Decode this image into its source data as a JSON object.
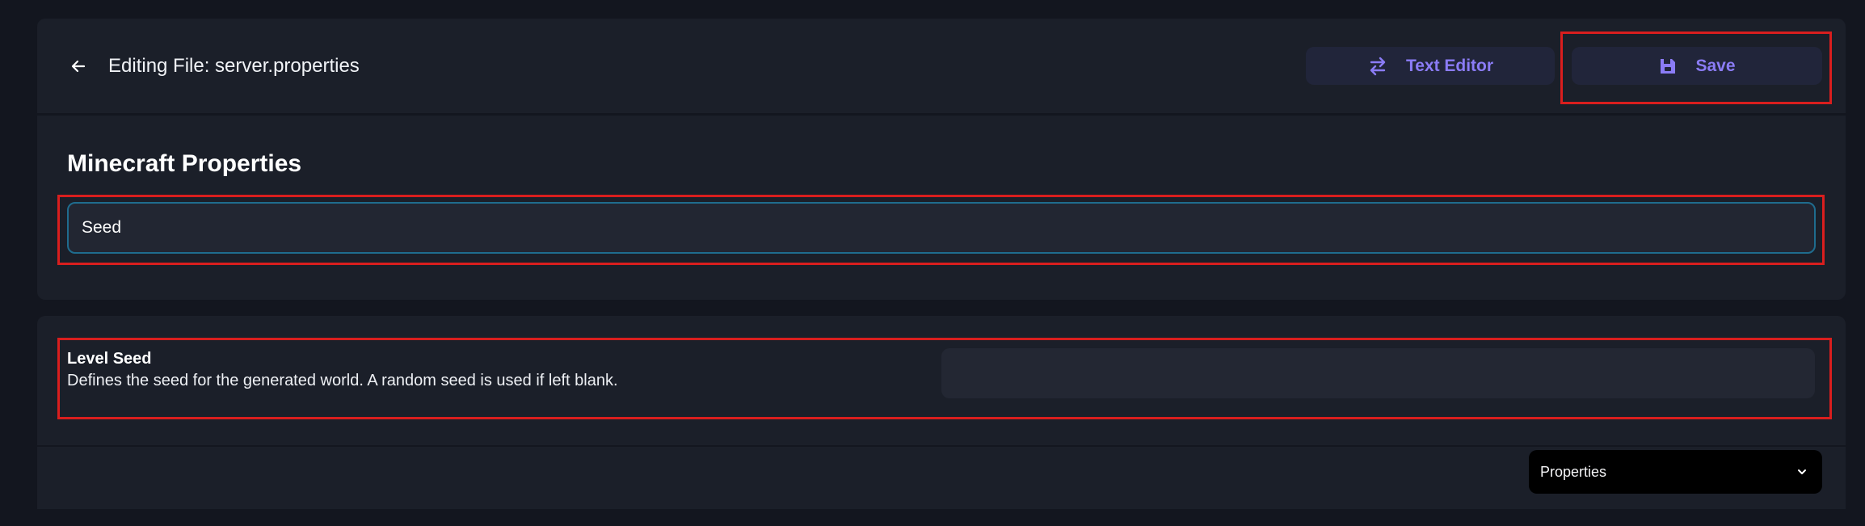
{
  "header": {
    "title": "Editing File: server.properties",
    "text_editor_label": "Text Editor",
    "save_label": "Save"
  },
  "properties": {
    "title": "Minecraft Properties",
    "search_value": "Seed"
  },
  "results": [
    {
      "name": "Level Seed",
      "description": "Defines the seed for the generated world. A random seed is used if left blank.",
      "value": ""
    }
  ],
  "footer": {
    "view_select_value": "Properties"
  },
  "colors": {
    "accent": "#8b7cf6",
    "background": "#13161f",
    "panel": "#1b1f29",
    "highlight": "#d91e1e"
  },
  "icons": [
    "arrow-left-icon",
    "swap-arrows-icon",
    "floppy-disk-icon",
    "chevron-down-icon"
  ]
}
